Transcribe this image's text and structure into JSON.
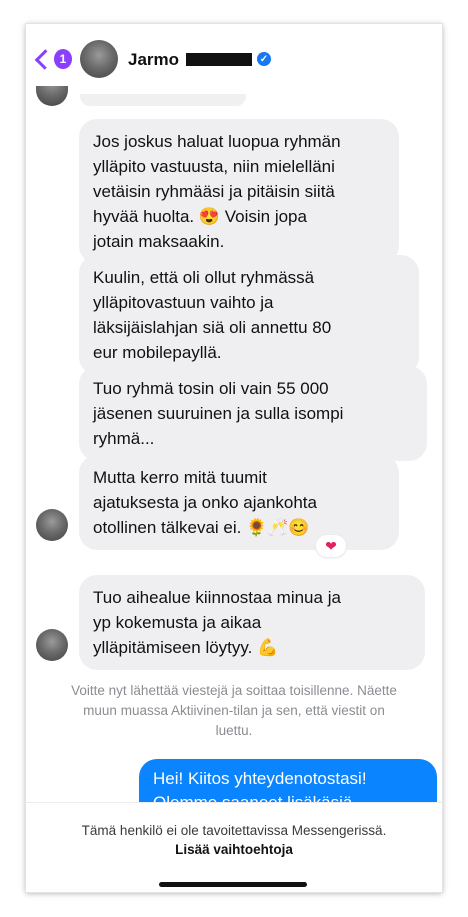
{
  "header": {
    "back_badge": "1",
    "contact_name": "Jarmo",
    "verified_icon": "✓"
  },
  "messages": [
    {
      "sender": "contact",
      "text": "Jos joskus haluat luopua ryhmän\nylläpito vastuusta, niin mielelläni\nvetäisin ryhmääsi ja pitäisin siitä\nhyvää huolta. 😍 Voisin jopa\njotain maksaakin."
    },
    {
      "sender": "contact",
      "text": "Kuulin, että oli ollut ryhmässä\nylläpitovastuun vaihto ja\nläksijäislahjan siä oli annettu 80\neur mobilepayllä."
    },
    {
      "sender": "contact",
      "text": "Tuo ryhmä tosin oli vain 55 000\njäsenen suuruinen ja sulla isompi\nryhmä..."
    },
    {
      "sender": "contact",
      "text": "Mutta kerro mitä tuumit\najatuksesta ja onko ajankohta\notollinen tälkevai ei. 🌻🥂😊",
      "reaction": "❤"
    },
    {
      "sender": "contact",
      "text": "Tuo aihealue kiinnostaa minua ja\nyp kokemusta ja aikaa\nylläpitämiseen löytyy. 💪"
    }
  ],
  "system_note": "Voitte nyt lähettää viestejä ja soittaa toisillenne. Näette\nmuun muassa Aktiivinen-tilan ja sen, että viestit on\nluettu.",
  "outgoing": {
    "text": "Hei! Kiitos yhteydenotostasi!\nOlemme saaneet lisäkäsiä"
  },
  "footer": {
    "unavailable_text": "Tämä henkilö ei ole tavoitettavissa Messengerissä.",
    "more_options_label": "Lisää vaihtoehtoja"
  },
  "colors": {
    "accent_purple": "#8a3ffc",
    "outgoing_blue": "#0a84ff",
    "incoming_gray": "#efeff1",
    "verified_blue": "#1877f2"
  }
}
